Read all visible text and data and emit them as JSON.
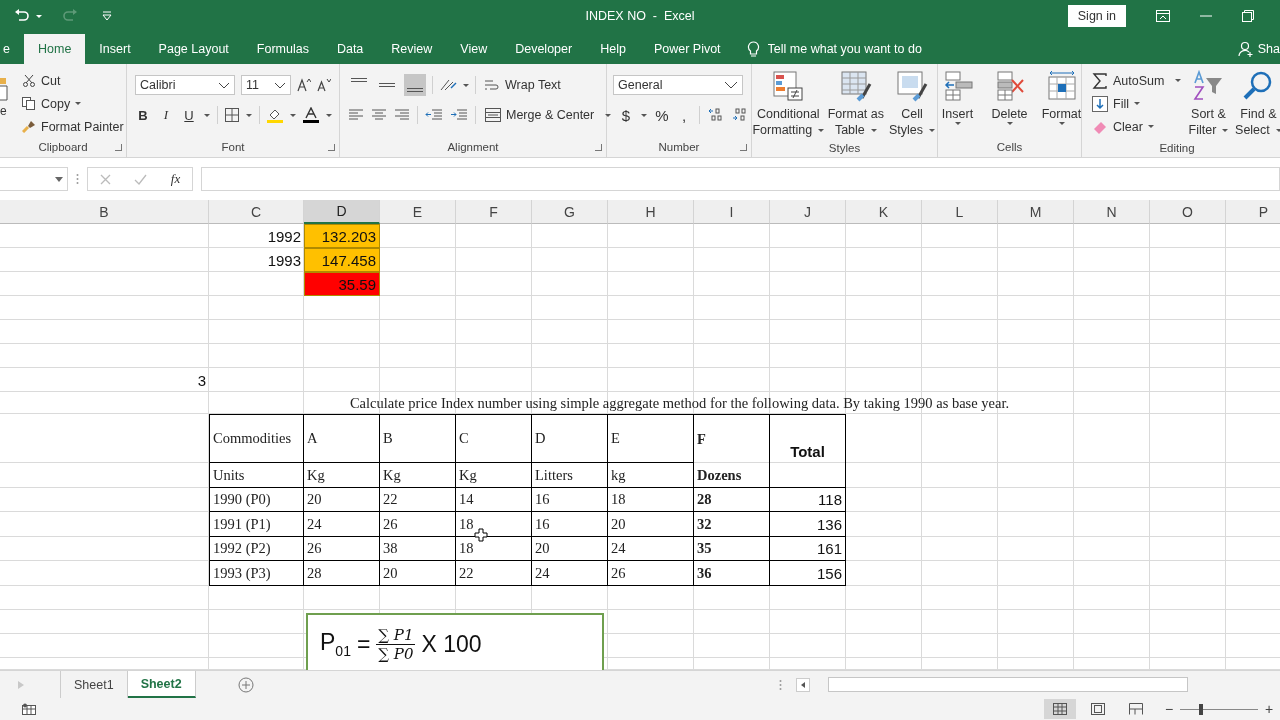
{
  "title_bar": {
    "title": "INDEX NO  -  Excel",
    "sign_in": "Sign in"
  },
  "tabs": [
    {
      "label": "e",
      "selected": false
    },
    {
      "label": "Home",
      "selected": true
    },
    {
      "label": "Insert",
      "selected": false
    },
    {
      "label": "Page Layout",
      "selected": false
    },
    {
      "label": "Formulas",
      "selected": false
    },
    {
      "label": "Data",
      "selected": false
    },
    {
      "label": "Review",
      "selected": false
    },
    {
      "label": "View",
      "selected": false
    },
    {
      "label": "Developer",
      "selected": false
    },
    {
      "label": "Help",
      "selected": false
    },
    {
      "label": "Power Pivot",
      "selected": false
    }
  ],
  "tell_me": {
    "placeholder": "Tell me what you want to do"
  },
  "share": "Sha",
  "ribbon": {
    "clipboard": {
      "paste": "e",
      "cut": "Cut",
      "copy": "Copy",
      "format_painter": "Format Painter",
      "label": "Clipboard"
    },
    "font": {
      "name": "Calibri",
      "size": "11",
      "bold": "B",
      "italic": "I",
      "underline": "U",
      "label": "Font"
    },
    "alignment": {
      "vertical": [
        {
          "kind": "top",
          "selected": false
        },
        {
          "kind": "middle",
          "selected": false
        },
        {
          "kind": "bottom",
          "selected": true
        }
      ],
      "wrap_text": "Wrap Text",
      "merge": "Merge & Center",
      "label": "Alignment"
    },
    "number": {
      "format": "General",
      "currency": "$",
      "percent": "%",
      "comma": ",",
      "label": "Number"
    },
    "styles": {
      "buttons": [
        {
          "kind": "conditional",
          "lines": [
            "Conditional",
            "Formatting"
          ]
        },
        {
          "kind": "table",
          "lines": [
            "Format as",
            "Table"
          ]
        },
        {
          "kind": "cell",
          "lines": [
            "Cell",
            "Styles"
          ]
        }
      ],
      "label": "Styles"
    },
    "cells": {
      "buttons": [
        {
          "kind": "insert",
          "label": "Insert"
        },
        {
          "kind": "delete",
          "label": "Delete"
        },
        {
          "kind": "format",
          "label": "Format"
        }
      ],
      "label": "Cells"
    },
    "editing": {
      "autosum": "AutoSum",
      "fill": "Fill",
      "clear": "Clear",
      "buttons": [
        {
          "kind": "sort",
          "lines": [
            "Sort &",
            "Filter"
          ]
        },
        {
          "kind": "find",
          "lines": [
            "Find &",
            "Select"
          ]
        }
      ],
      "label": "Editing"
    }
  },
  "formula_bar": {
    "fx": "fx"
  },
  "columns": [
    {
      "label": "B",
      "selected": false
    },
    {
      "label": "C",
      "selected": false
    },
    {
      "label": "D",
      "selected": true
    },
    {
      "label": "E",
      "selected": false
    },
    {
      "label": "F",
      "selected": false
    },
    {
      "label": "G",
      "selected": false
    },
    {
      "label": "H",
      "selected": false
    },
    {
      "label": "I",
      "selected": false
    },
    {
      "label": "J",
      "selected": false
    },
    {
      "label": "K",
      "selected": false
    },
    {
      "label": "L",
      "selected": false
    },
    {
      "label": "M",
      "selected": false
    },
    {
      "label": "N",
      "selected": false
    },
    {
      "label": "O",
      "selected": false
    },
    {
      "label": "P",
      "selected": false
    }
  ],
  "results": [
    {
      "year": "1992",
      "value": "132.203",
      "color": "#ffc000"
    },
    {
      "year": "1993",
      "value": "147.458",
      "color": "#ffc000"
    },
    {
      "value": "35.59",
      "color": "#ff0000"
    }
  ],
  "question_number": "3",
  "question": "Calculate price Index number using simple aggregate method for the following data. By taking 1990 as base year.",
  "table": {
    "header_label": "Commodities",
    "commodities": [
      "A",
      "B",
      "C",
      "D",
      "E",
      "F"
    ],
    "total_label": "Total",
    "units_label": "Units",
    "units": [
      "Kg",
      "Kg",
      "Kg",
      "Litters",
      "kg",
      "Dozens"
    ],
    "rows": [
      {
        "label": "1990 (P0)",
        "values": [
          "20",
          "22",
          "14",
          "16",
          "18",
          "28"
        ],
        "total": "118"
      },
      {
        "label": "1991 (P1)",
        "values": [
          "24",
          "26",
          "18",
          "16",
          "20",
          "32"
        ],
        "total": "136"
      },
      {
        "label": "1992 (P2)",
        "values": [
          "26",
          "38",
          "18",
          "20",
          "24",
          "35"
        ],
        "total": "161"
      },
      {
        "label": "1993 (P3)",
        "values": [
          "28",
          "20",
          "22",
          "24",
          "26",
          "36"
        ],
        "total": "156"
      }
    ]
  },
  "formula": {
    "symbol": "P",
    "subscript": "01",
    "equals": "=",
    "numerator": "∑ P1",
    "denominator": "∑ P0",
    "multiplier": "X 100"
  },
  "sheets": [
    {
      "label": "Sheet1",
      "selected": false
    },
    {
      "label": "Sheet2",
      "selected": true
    }
  ],
  "zoom": {
    "minus": "−",
    "plus": "+",
    "level": 0.27
  }
}
